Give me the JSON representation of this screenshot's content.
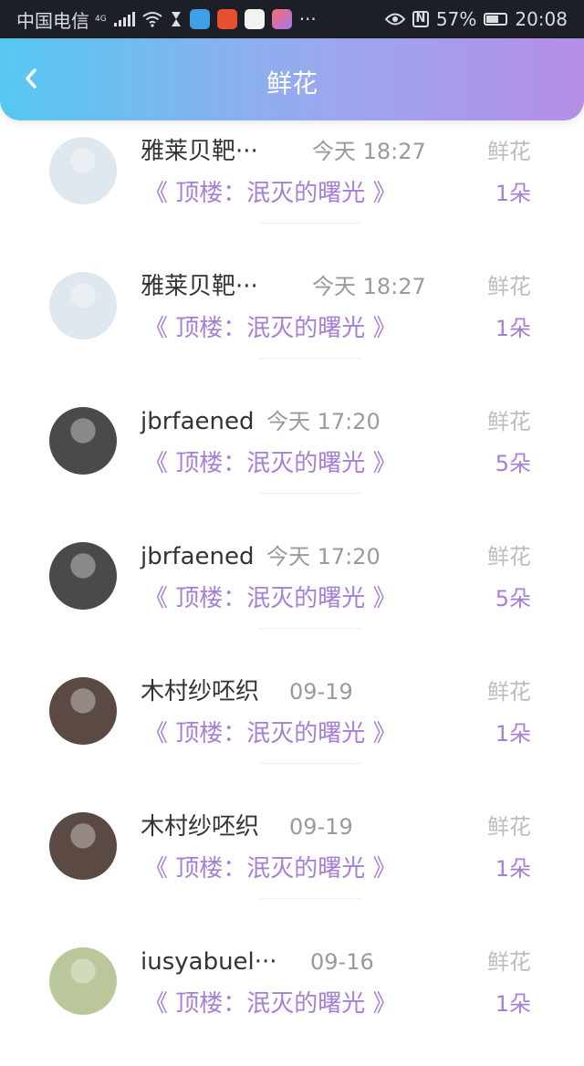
{
  "status_bar": {
    "carrier": "中国电信",
    "network": "4G",
    "ellipsis": "···",
    "battery": "57%",
    "time": "20:08"
  },
  "header": {
    "title": "鲜花"
  },
  "items": [
    {
      "name": "雅莱贝靶···",
      "time": "今天 18:27",
      "label": "鲜花",
      "book": "《 顶楼：泯灭的曙光 》",
      "count": "1朵",
      "avatar_color": "#dfe7ef"
    },
    {
      "name": "雅莱贝靶···",
      "time": "今天 18:27",
      "label": "鲜花",
      "book": "《 顶楼：泯灭的曙光 》",
      "count": "1朵",
      "avatar_color": "#dfe7ef"
    },
    {
      "name": "jbrfaened",
      "time": "今天 17:20",
      "label": "鲜花",
      "book": "《 顶楼：泯灭的曙光 》",
      "count": "5朵",
      "avatar_color": "#4a4a4a"
    },
    {
      "name": "jbrfaened",
      "time": "今天 17:20",
      "label": "鲜花",
      "book": "《 顶楼：泯灭的曙光 》",
      "count": "5朵",
      "avatar_color": "#4a4a4a"
    },
    {
      "name": "木村纱呸织",
      "time": "09-19",
      "label": "鲜花",
      "book": "《 顶楼：泯灭的曙光 》",
      "count": "1朵",
      "avatar_color": "#5b4a44"
    },
    {
      "name": "木村纱呸织",
      "time": "09-19",
      "label": "鲜花",
      "book": "《 顶楼：泯灭的曙光 》",
      "count": "1朵",
      "avatar_color": "#5b4a44"
    },
    {
      "name": "iusyabuel···",
      "time": "09-16",
      "label": "鲜花",
      "book": "《 顶楼：泯灭的曙光 》",
      "count": "1朵",
      "avatar_color": "#b9c79a"
    }
  ]
}
